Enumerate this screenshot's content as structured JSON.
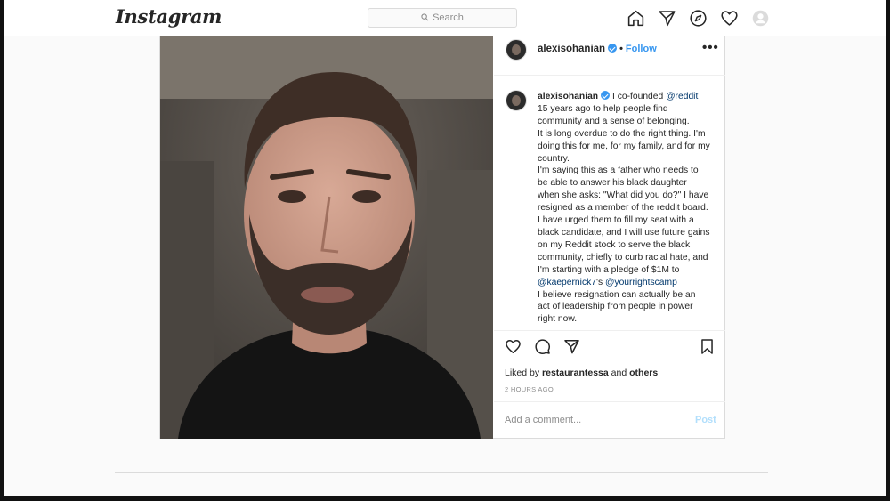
{
  "nav": {
    "logo_text": "Instagram",
    "search_placeholder": "Search",
    "icons": [
      "home-icon",
      "direct-icon",
      "explore-icon",
      "activity-heart-icon",
      "profile-avatar-icon"
    ]
  },
  "post": {
    "username": "alexisohanian",
    "separator": "•",
    "follow_label": "Follow",
    "more_label": "•••",
    "caption": {
      "username": "alexisohanian",
      "line1_pre": "I co-founded",
      "line1_tag": "@reddit",
      "line1_post": "15 years ago to help people find community and a sense of belonging.",
      "p2": "It is long overdue to do the right thing. I'm doing this for me, for my family, and for my country.",
      "p3_pre": "I'm saying this as a father who needs to be able to answer his black daughter when she asks: \"What did you do?\" I have resigned as a member of the reddit board. I have urged them to fill my seat with a black candidate, and I will use future gains on my Reddit stock to serve the black community, chiefly to curb racial hate, and I'm starting with a pledge of $1M to",
      "p3_tag1": "@kaepernick7",
      "p3_mid": "'s",
      "p3_tag2": "@yourrightscamp",
      "p4": "I believe resignation can actually be an act of leadership from people in power right now."
    },
    "likes": {
      "prefix": "Liked by",
      "user": "restaurantessa",
      "and": "and",
      "others": "others"
    },
    "timestamp": "2 HOURS AGO",
    "comment_placeholder": "Add a comment...",
    "post_button": "Post"
  },
  "colors": {
    "link_blue": "#3897f0",
    "mention_blue": "#00376b",
    "muted": "#8e8e8e",
    "border": "#dbdbdb"
  }
}
